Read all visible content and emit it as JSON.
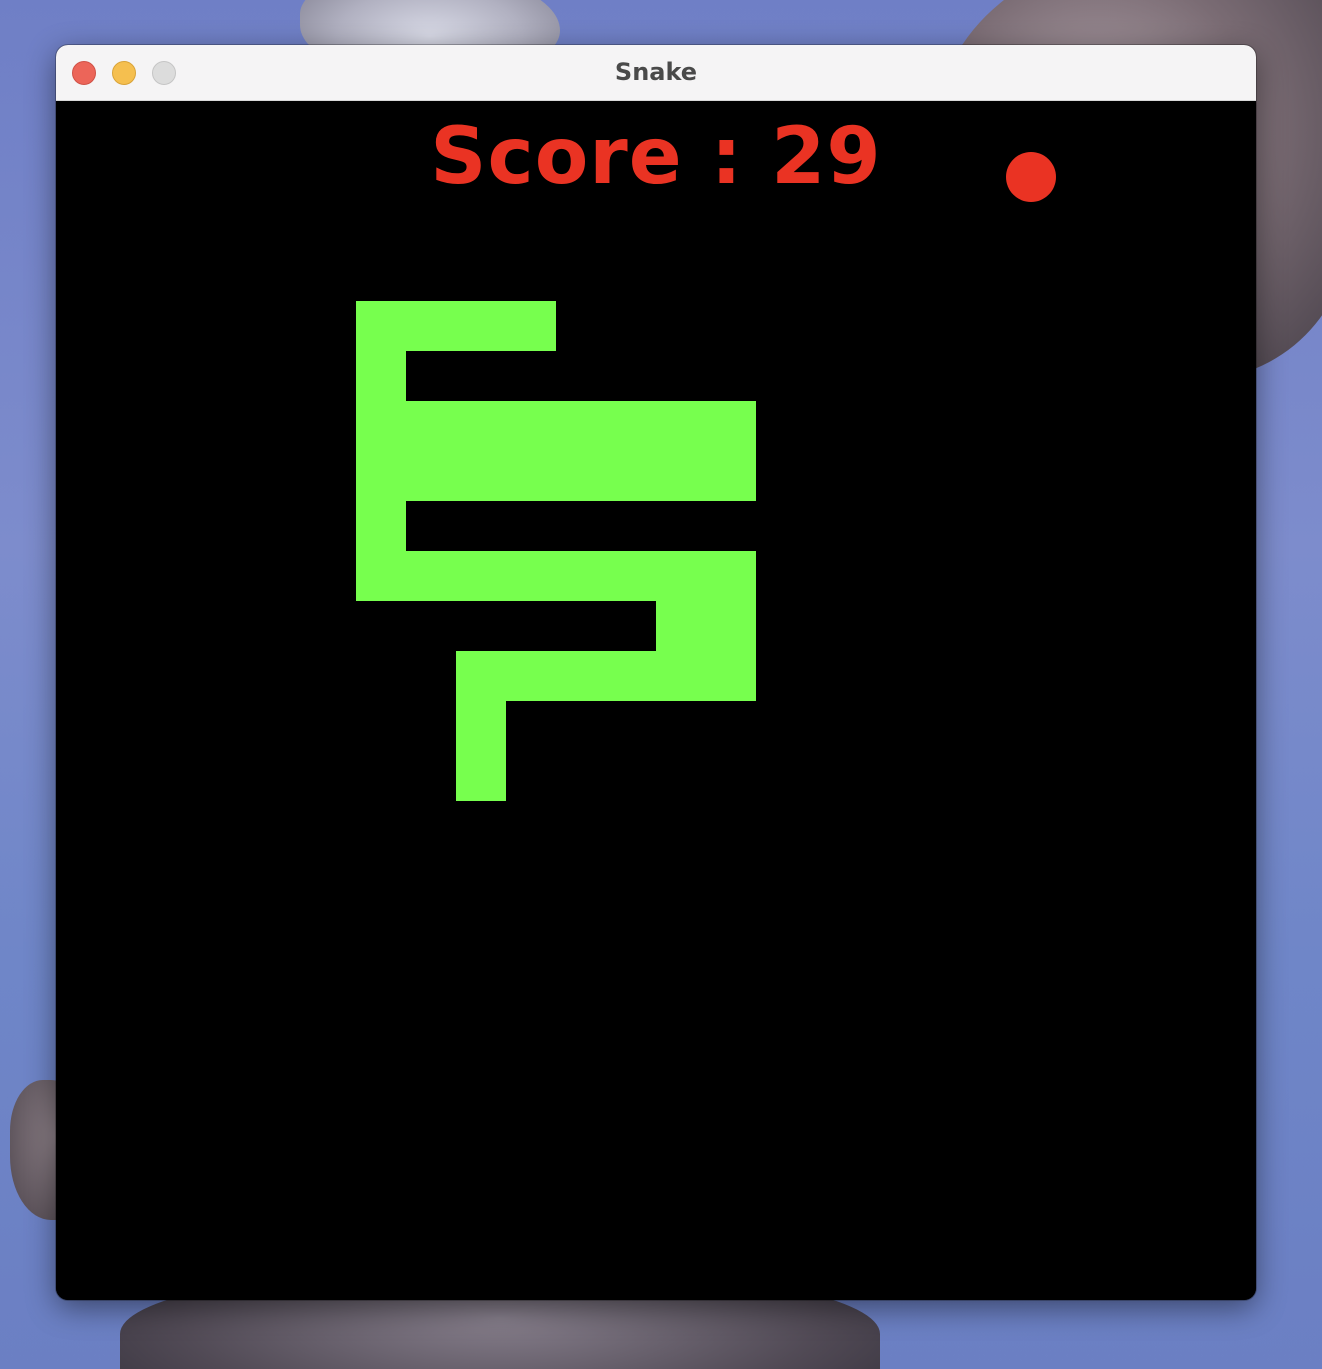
{
  "window": {
    "title": "Snake"
  },
  "game": {
    "score_label": "Score : 29",
    "score": 29,
    "colors": {
      "background": "#000000",
      "snake": "#77ff4e",
      "food": "#ea3323",
      "score_text": "#ea3323"
    },
    "grid_cell_count": 24,
    "snake_cells": [
      [
        6,
        4
      ],
      [
        7,
        4
      ],
      [
        8,
        4
      ],
      [
        9,
        4
      ],
      [
        6,
        5
      ],
      [
        6,
        6
      ],
      [
        7,
        6
      ],
      [
        8,
        6
      ],
      [
        9,
        6
      ],
      [
        10,
        6
      ],
      [
        11,
        6
      ],
      [
        12,
        6
      ],
      [
        13,
        6
      ],
      [
        6,
        7
      ],
      [
        7,
        7
      ],
      [
        8,
        7
      ],
      [
        9,
        7
      ],
      [
        10,
        7
      ],
      [
        11,
        7
      ],
      [
        12,
        7
      ],
      [
        13,
        7
      ],
      [
        6,
        8
      ],
      [
        6,
        9
      ],
      [
        7,
        9
      ],
      [
        8,
        9
      ],
      [
        9,
        9
      ],
      [
        10,
        9
      ],
      [
        11,
        9
      ],
      [
        12,
        9
      ],
      [
        13,
        9
      ],
      [
        12,
        10
      ],
      [
        13,
        10
      ],
      [
        8,
        11
      ],
      [
        9,
        11
      ],
      [
        10,
        11
      ],
      [
        11,
        11
      ],
      [
        12,
        11
      ],
      [
        13,
        11
      ],
      [
        8,
        12
      ],
      [
        8,
        13
      ]
    ],
    "food_cell": [
      19,
      1
    ]
  }
}
